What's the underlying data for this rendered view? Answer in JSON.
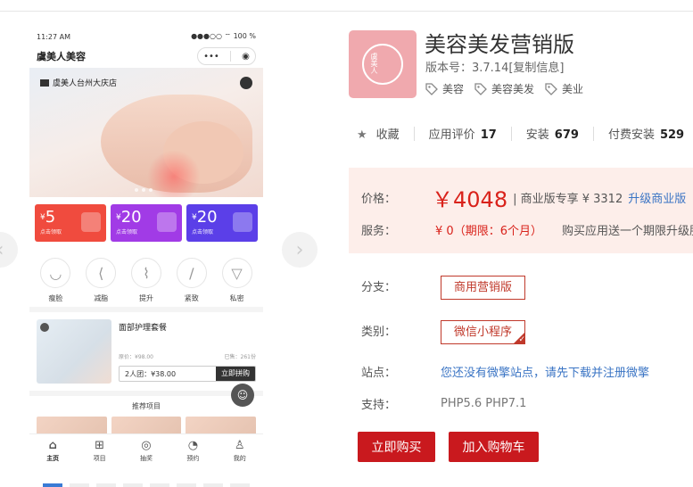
{
  "phone": {
    "status_time": "11:27 AM",
    "status_right": "●●●○○ ⌔ 100 %",
    "app_name": "虞美人美容",
    "store_name": "虞美人台州大庆店",
    "coupons": [
      {
        "amount": "5",
        "currency": "¥",
        "sub": "点击领取",
        "color": "#f04b3e"
      },
      {
        "amount": "20",
        "currency": "¥",
        "sub": "点击领取",
        "color": "#a13be6"
      },
      {
        "amount": "20",
        "currency": "¥",
        "sub": "点击领取",
        "color": "#5b3fe8"
      }
    ],
    "categories": [
      "瘦脸",
      "减脂",
      "提升",
      "紧致",
      "私密"
    ],
    "product": {
      "name": "面部护理套餐",
      "price_note": "原价：¥98.00",
      "sold_note": "已售：261份",
      "group_price": "2人团：¥38.00",
      "action": "立即拼购"
    },
    "recommend_title": "推荐项目",
    "tabs": [
      "主页",
      "项目",
      "抽奖",
      "预约",
      "我的"
    ]
  },
  "app": {
    "icon_text": "虞美人",
    "title": "美容美发营销版",
    "version": "版本号：3.7.14[复制信息]",
    "tags": [
      "美容",
      "美容美发",
      "美业"
    ],
    "favorite": "收藏",
    "rating_label": "应用评价",
    "rating_value": "17",
    "install_label": "安装",
    "install_value": "679",
    "paid_label": "付费安装",
    "paid_value": "529",
    "price_label": "价格：",
    "price": "￥4048",
    "pro_note": "| 商业版专享 ¥ 3312",
    "upgrade_link": "升级商业版",
    "service_label": "服务：",
    "service_value": "¥ 0（期限：6个月）",
    "service_note": "购买应用送一个期限升级服务",
    "branch_label": "分支：",
    "branch_value": "商用营销版",
    "category_label": "类别：",
    "category_value": "微信小程序",
    "site_label": "站点：",
    "site_value": "您还没有微擎站点，请先下载并注册微擎",
    "support_label": "支持：",
    "support_value": "PHP5.6   PHP7.1",
    "buy_label": "立即购买",
    "cart_label": "加入购物车"
  },
  "colors": {
    "accent_red": "#c9191e",
    "link_blue": "#3a74c4",
    "icon_pink": "#f0a9ae"
  }
}
